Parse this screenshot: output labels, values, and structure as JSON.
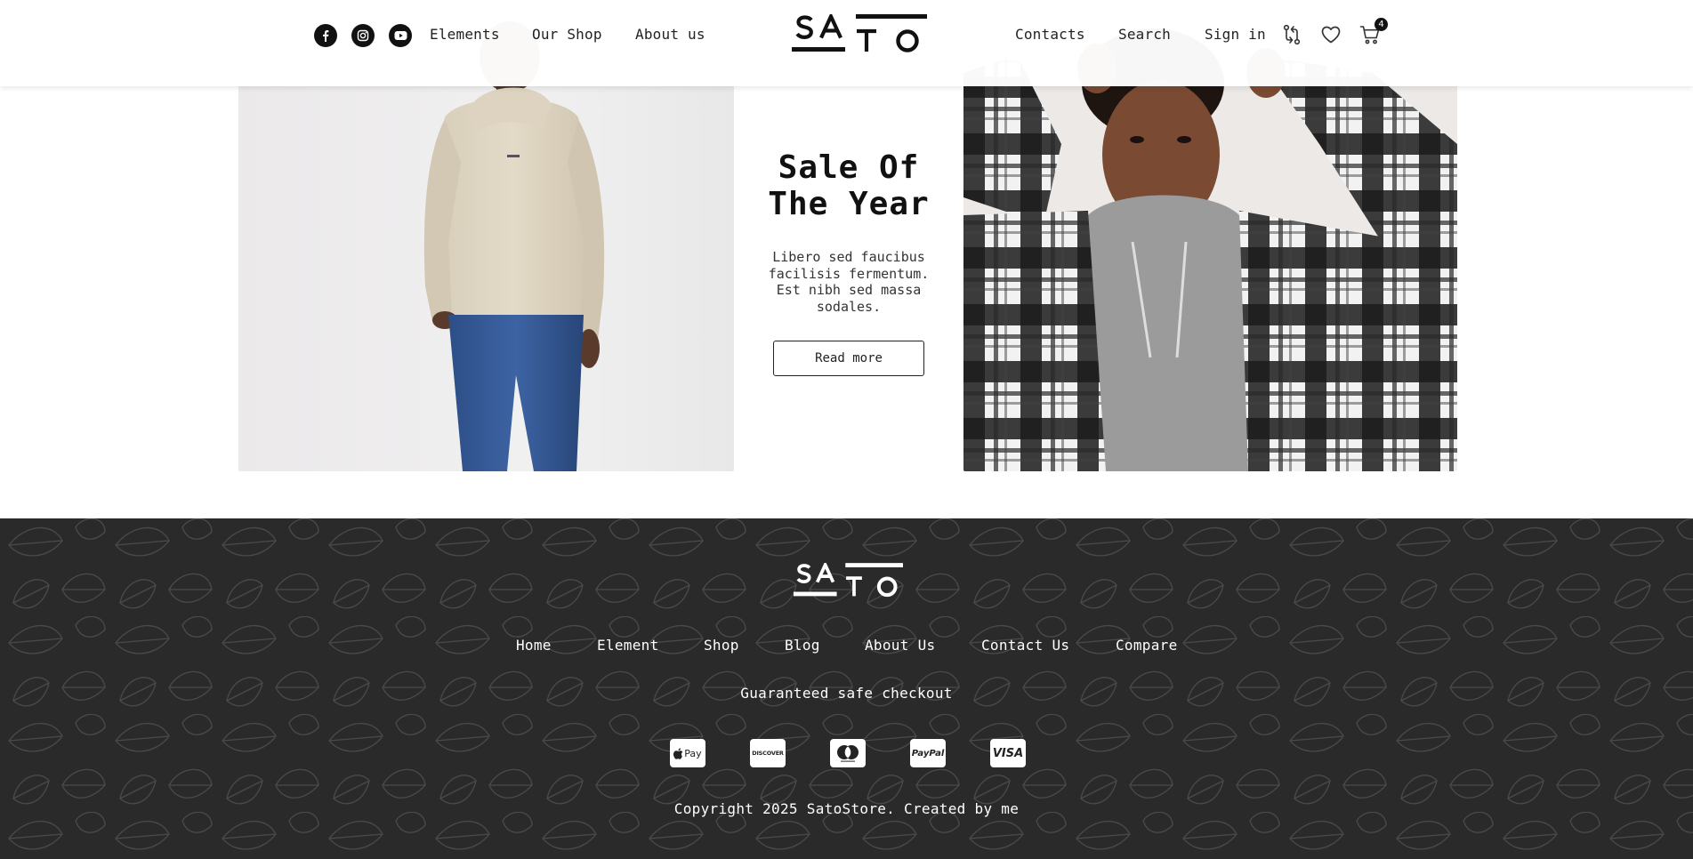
{
  "header": {
    "social": [
      "facebook-icon",
      "instagram-icon",
      "youtube-icon"
    ],
    "nav_left": [
      "Elements",
      "Our Shop",
      "About us"
    ],
    "logo": "SATO",
    "nav_right": [
      "Contacts",
      "Search",
      "Sign in"
    ],
    "icons": [
      "compare-icon",
      "heart-icon",
      "cart-icon"
    ],
    "cart_count": "4"
  },
  "hero": {
    "title_line1": "Sale Of",
    "title_line2": "The Year",
    "text_line1": "Libero sed faucibus",
    "text_line2": "facilisis fermentum.",
    "text_line3": "Est nibh sed massa",
    "text_line4": "sodales.",
    "button": "Read more"
  },
  "footer": {
    "logo": "SATO",
    "nav": [
      "Home",
      "Element",
      "Shop",
      "Blog",
      "About Us",
      "Contact Us",
      "Compare"
    ],
    "checkout": "Guaranteed safe checkout",
    "payments": [
      "apple-pay-icon",
      "discover-icon",
      "mastercard-icon",
      "paypal-icon",
      "visa-icon"
    ],
    "payment_labels": {
      "apple": "Pay",
      "discover": "DISCOVER",
      "paypal": "PayPal",
      "visa": "VISA"
    },
    "copyright": "Copyright 2025 SatoStore. Created by me"
  },
  "colors": {
    "header_bg": "#ffffff",
    "footer_bg": "#2a2a2a",
    "text_dark": "#111111",
    "text_light": "#ffffff"
  }
}
